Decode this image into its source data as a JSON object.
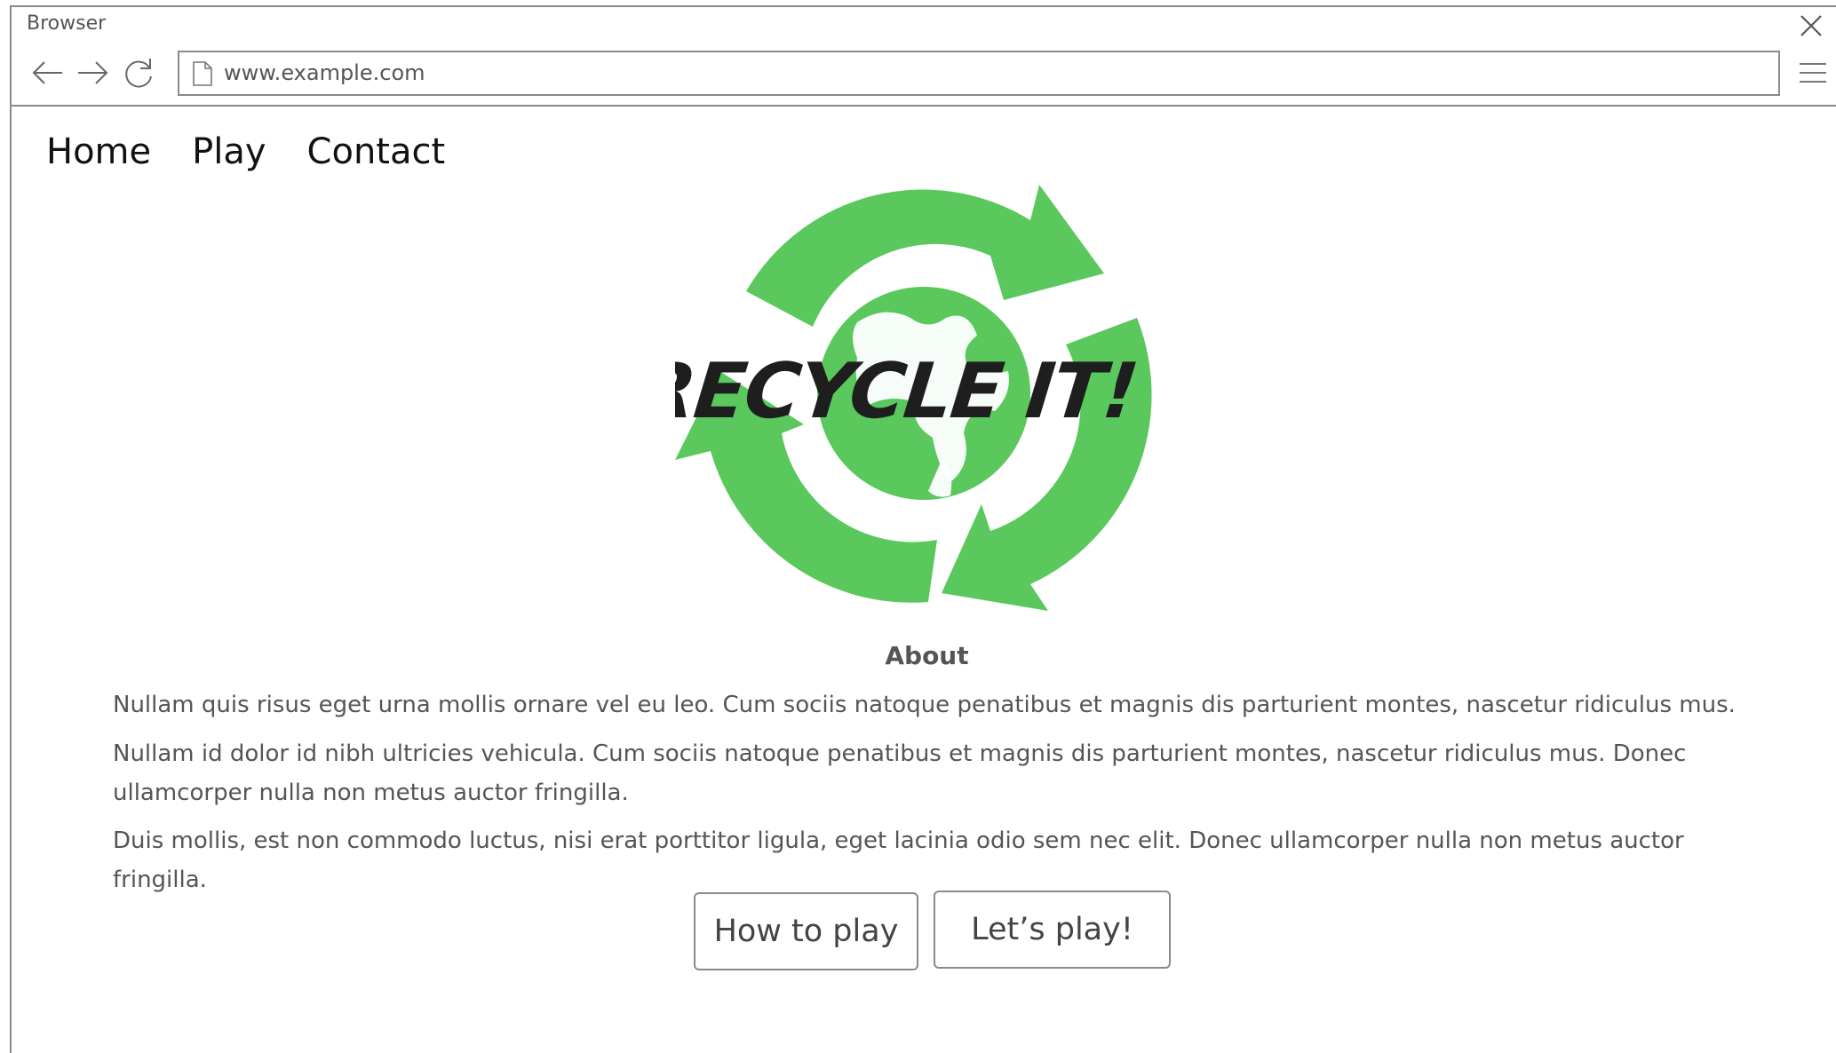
{
  "window": {
    "title": "Browser"
  },
  "browser": {
    "url": "www.example.com",
    "icons": {
      "back": "arrow-left-icon",
      "forward": "arrow-right-icon",
      "reload": "reload-icon",
      "page": "file-icon",
      "menu": "hamburger-menu-icon",
      "close": "close-icon"
    }
  },
  "nav": {
    "items": [
      {
        "label": "Home"
      },
      {
        "label": "Play"
      },
      {
        "label": "Contact"
      }
    ]
  },
  "logo": {
    "text": "RECYCLE IT!",
    "arrow_color": "#5ac85c",
    "text_color": "#1e1e1e"
  },
  "about": {
    "heading": "About",
    "paragraphs": [
      "Nullam quis risus eget urna mollis ornare vel eu leo. Cum sociis natoque penatibus et magnis dis parturient montes, nascetur ridiculus mus.",
      "Nullam id dolor id nibh ultricies vehicula. Cum sociis natoque penatibus et magnis dis parturient montes, nascetur ridiculus mus. Donec ullamcorper nulla non metus auctor fringilla.",
      "Duis mollis, est non commodo luctus, nisi erat porttitor ligula, eget lacinia odio sem nec elit. Donec ullamcorper nulla non metus auctor fringilla."
    ]
  },
  "buttons": {
    "how_to_play": "How to play",
    "lets_play": "Let’s play!"
  }
}
